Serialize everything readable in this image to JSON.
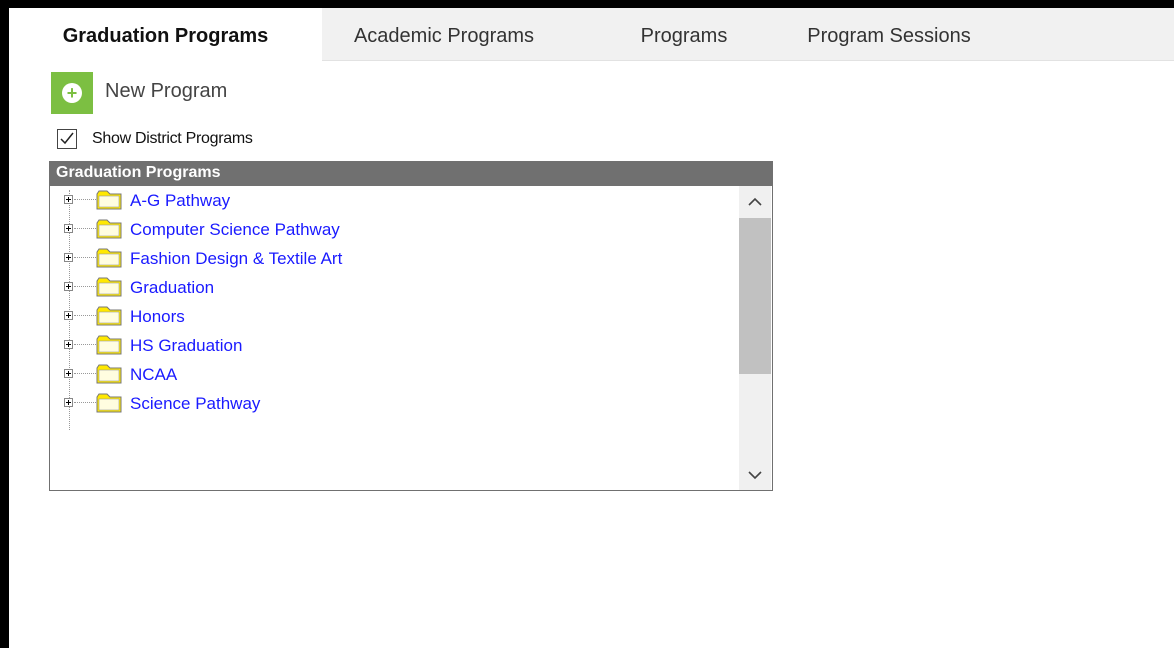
{
  "tabs": [
    {
      "label": "Graduation Programs",
      "active": true
    },
    {
      "label": "Academic Programs",
      "active": false
    },
    {
      "label": "Programs",
      "active": false
    },
    {
      "label": "Program Sessions",
      "active": false
    }
  ],
  "toolbar": {
    "new_program_label": "New Program",
    "new_program_icon": "plus-circle-icon",
    "accent_color": "#7cbf42"
  },
  "show_district": {
    "label": "Show District Programs",
    "checked": true
  },
  "panel": {
    "title": "Graduation Programs",
    "items": [
      {
        "label": "A-G Pathway"
      },
      {
        "label": "Computer Science Pathway"
      },
      {
        "label": "Fashion Design & Textile Art"
      },
      {
        "label": "Graduation"
      },
      {
        "label": "Honors"
      },
      {
        "label": "HS Graduation"
      },
      {
        "label": "NCAA"
      },
      {
        "label": "Science Pathway"
      }
    ],
    "link_color": "#1a1aff",
    "header_color": "#707070"
  }
}
